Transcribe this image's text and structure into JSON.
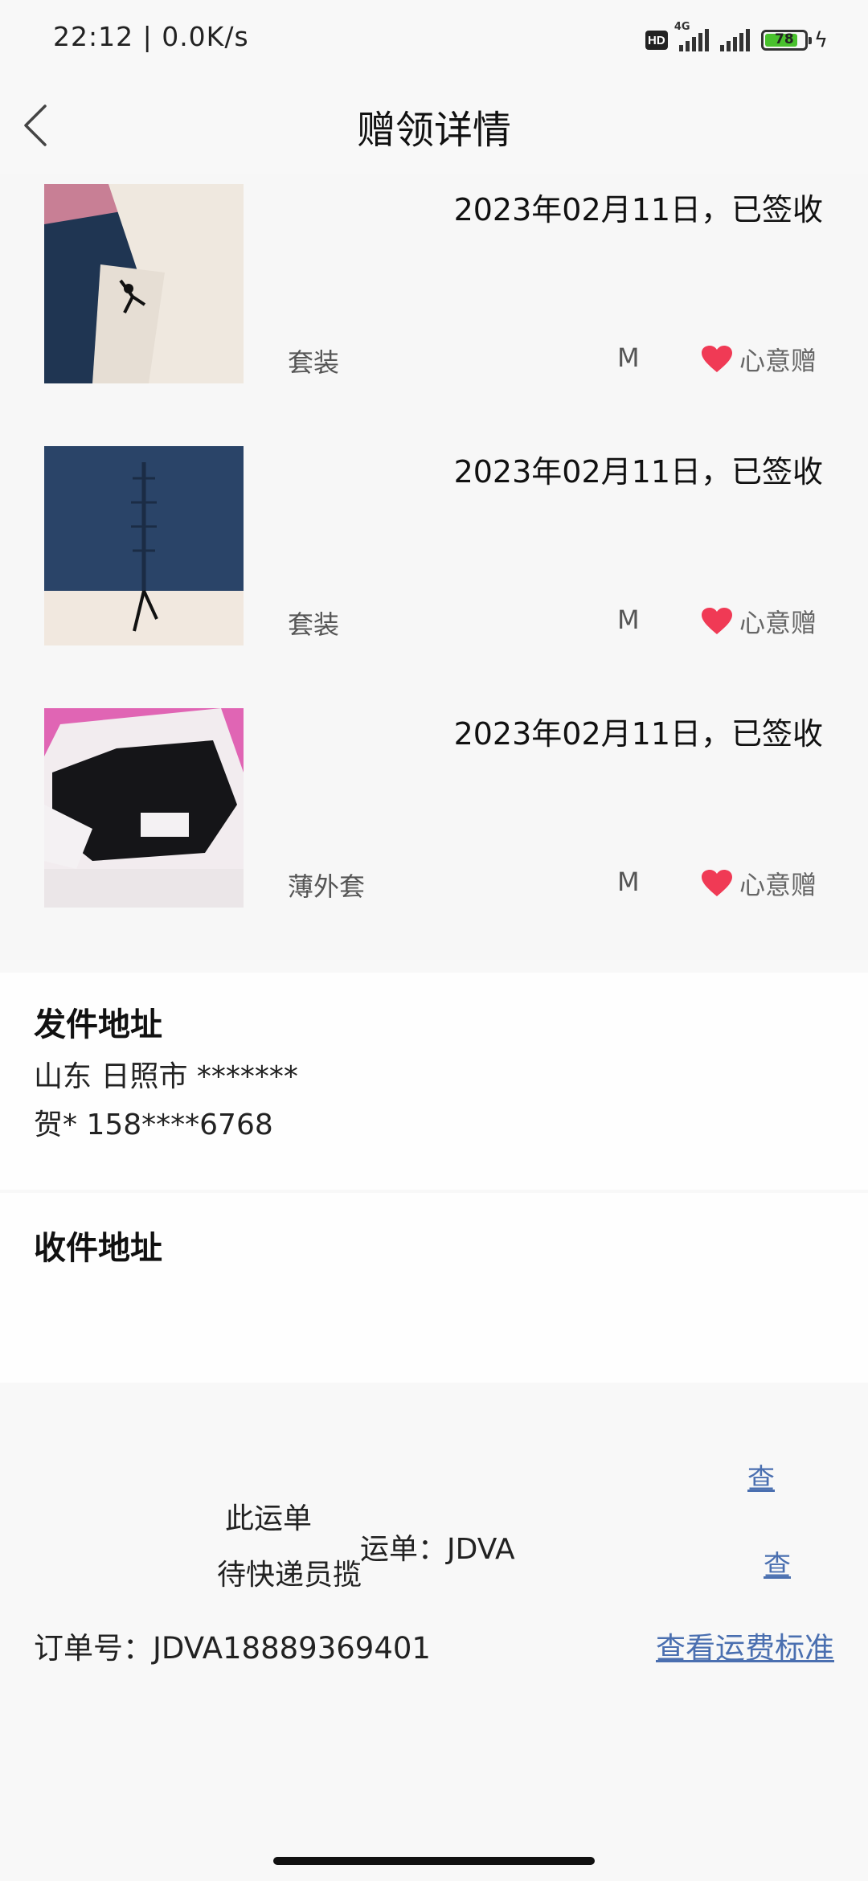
{
  "status_bar": {
    "time": "22:12 | 0.0K/s",
    "hd": "HD",
    "network": "4G",
    "battery": "78"
  },
  "header": {
    "title": "赠领详情"
  },
  "items": [
    {
      "date": "2023年02月11日，已签收",
      "category": "套装",
      "size": "M",
      "tag": "心意赠"
    },
    {
      "date": "2023年02月11日，已签收",
      "category": "套装",
      "size": "M",
      "tag": "心意赠"
    },
    {
      "date": "2023年02月11日，已签收",
      "category": "薄外套",
      "size": "M",
      "tag": "心意赠"
    }
  ],
  "sender": {
    "title": "发件地址",
    "address": "山东 日照市 *******",
    "contact": "贺* 158****6768"
  },
  "receiver": {
    "title": "收件地址"
  },
  "waybill": {
    "line1": "此运单",
    "line2": "待快递员揽",
    "number_fragment": "运单：JDVA",
    "link1": "查",
    "link2": "查"
  },
  "order": {
    "label": "订单号：JDVA18889369401",
    "fee_link": "查看运费标准"
  },
  "colors": {
    "accent_link": "#4a6fb0",
    "heart": "#f03a55"
  }
}
